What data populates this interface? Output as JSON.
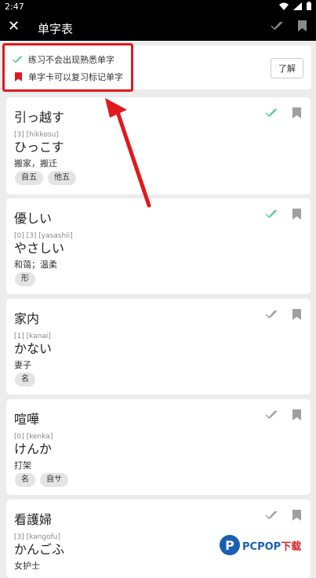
{
  "status": {
    "time": "2:47"
  },
  "appbar": {
    "title": "单字表",
    "close_glyph": "✕"
  },
  "info": {
    "line1": "练习不会出现熟悉单字",
    "line2": "单字卡可以复习标记单字",
    "button": "了解"
  },
  "cards": [
    {
      "word": "引っ越す",
      "romaji": "[3] [hikkosu]",
      "kana": "ひっこす",
      "meaning": "搬家，搬迁",
      "tags": [
        "自五",
        "他五"
      ],
      "check": "mastered"
    },
    {
      "word": "優しい",
      "romaji": "[0] [3] [yasashii]",
      "kana": "やさしい",
      "meaning": "和蔼；温柔",
      "tags": [
        "形"
      ],
      "check": "mastered"
    },
    {
      "word": "家内",
      "romaji": "[1] [kanai]",
      "kana": "かない",
      "meaning": "妻子",
      "tags": [
        "名"
      ],
      "check": "none"
    },
    {
      "word": "喧嘩",
      "romaji": "[0] [kenka]",
      "kana": "けんか",
      "meaning": "打架",
      "tags": [
        "名",
        "自サ"
      ],
      "check": "none"
    },
    {
      "word": "看護婦",
      "romaji": "[3] [kangofu]",
      "kana": "かんごふ",
      "meaning": "女护士",
      "tags": [],
      "check": "none"
    }
  ],
  "colors": {
    "mastered": "#5fc9a6",
    "unmastered": "#a0a0a0",
    "highlight": "#e0191e",
    "bookmark_red": "#e0191e"
  },
  "watermark": {
    "logo": "P",
    "text_a": "PCPOP",
    "text_b": "下载"
  }
}
